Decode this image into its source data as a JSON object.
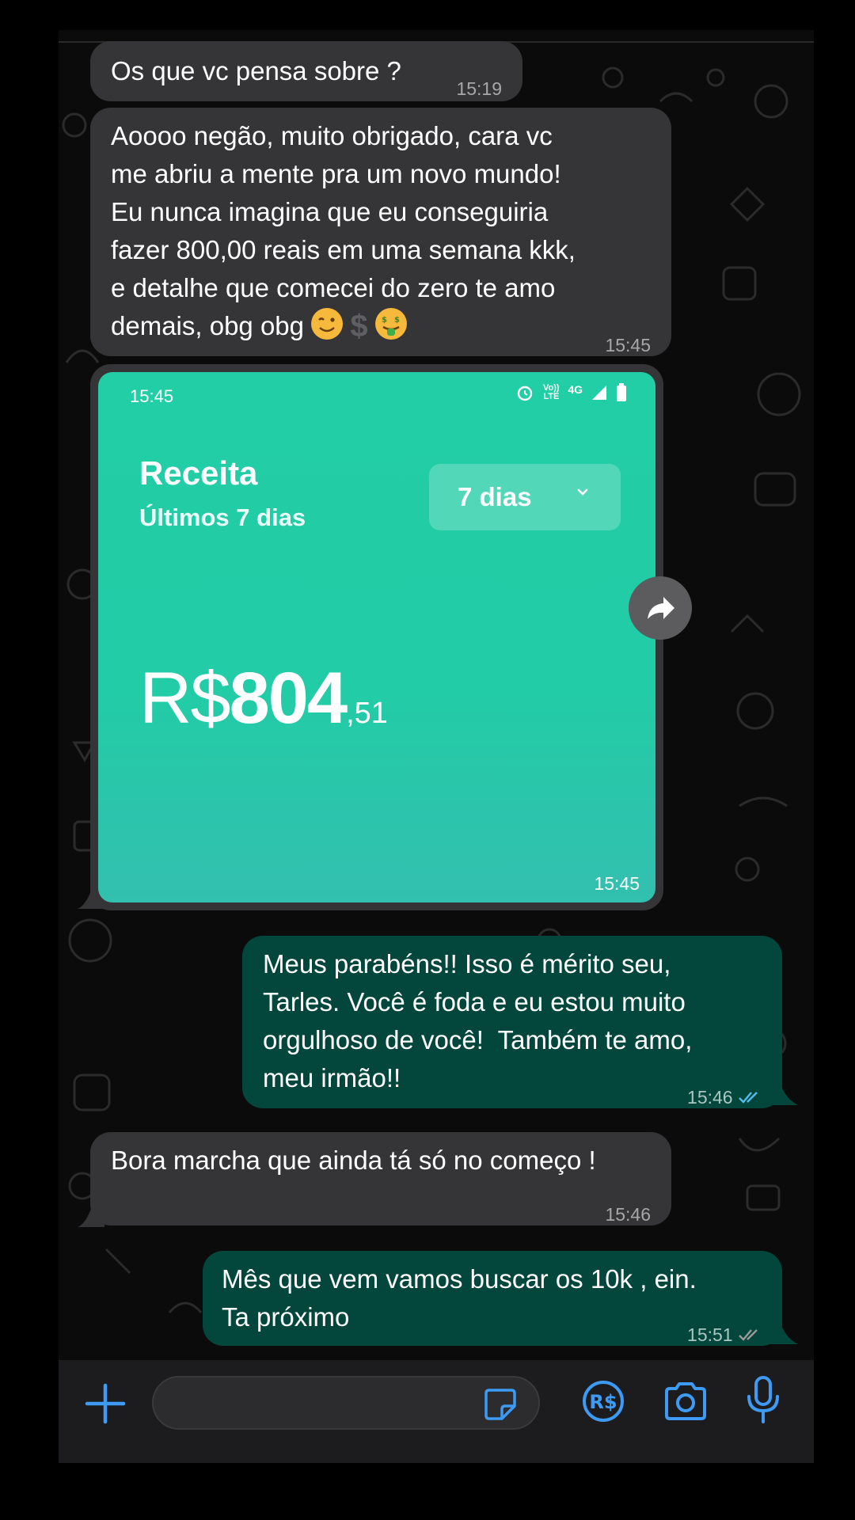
{
  "messages": [
    {
      "text": "Os que vc pensa sobre ?",
      "time": "15:19"
    },
    {
      "text": "Aoooo negão, muito obrigado, cara vc\nme abriu a mente pra um novo mundo!\nEu nunca imagina que eu conseguiria\nfazer 800,00 reais em uma semana kkk,\ne detalhe que comecei do zero te amo\ndemais, obg obg ",
      "time": "15:45"
    },
    {
      "text": "Meus parabéns!! Isso é mérito seu,\nTarles. Você é foda e eu estou muito\norgulhoso de você!  Também te amo,\nmeu irmão!!",
      "time": "15:46"
    },
    {
      "text": "Bora marcha que ainda tá só no começo !",
      "time": "15:46"
    },
    {
      "text": "Mês que vem vamos buscar os 10k , ein.\nTa próximo",
      "time": "15:51"
    }
  ],
  "emojis": [
    "winking-face",
    "heavy-dollar-sign",
    "money-mouth-face"
  ],
  "screenshot": {
    "status_time": "15:45",
    "status_network": "4G",
    "status_volte": "Vo)) LTE",
    "title": "Receita",
    "subtitle": "Últimos 7 dias",
    "period": "7 dias",
    "currency": "R$",
    "amount_int": "804",
    "amount_cents": ",51",
    "time": "15:45"
  },
  "input_bar": {
    "icons": [
      "plus-icon",
      "sticker-icon",
      "pix-payment-icon",
      "camera-icon",
      "microphone-icon"
    ]
  },
  "colors": {
    "received_bubble": "#353537",
    "sent_bubble": "#03473c",
    "accent": "#3d9bf5",
    "read_ticks": "#53bdeb"
  }
}
